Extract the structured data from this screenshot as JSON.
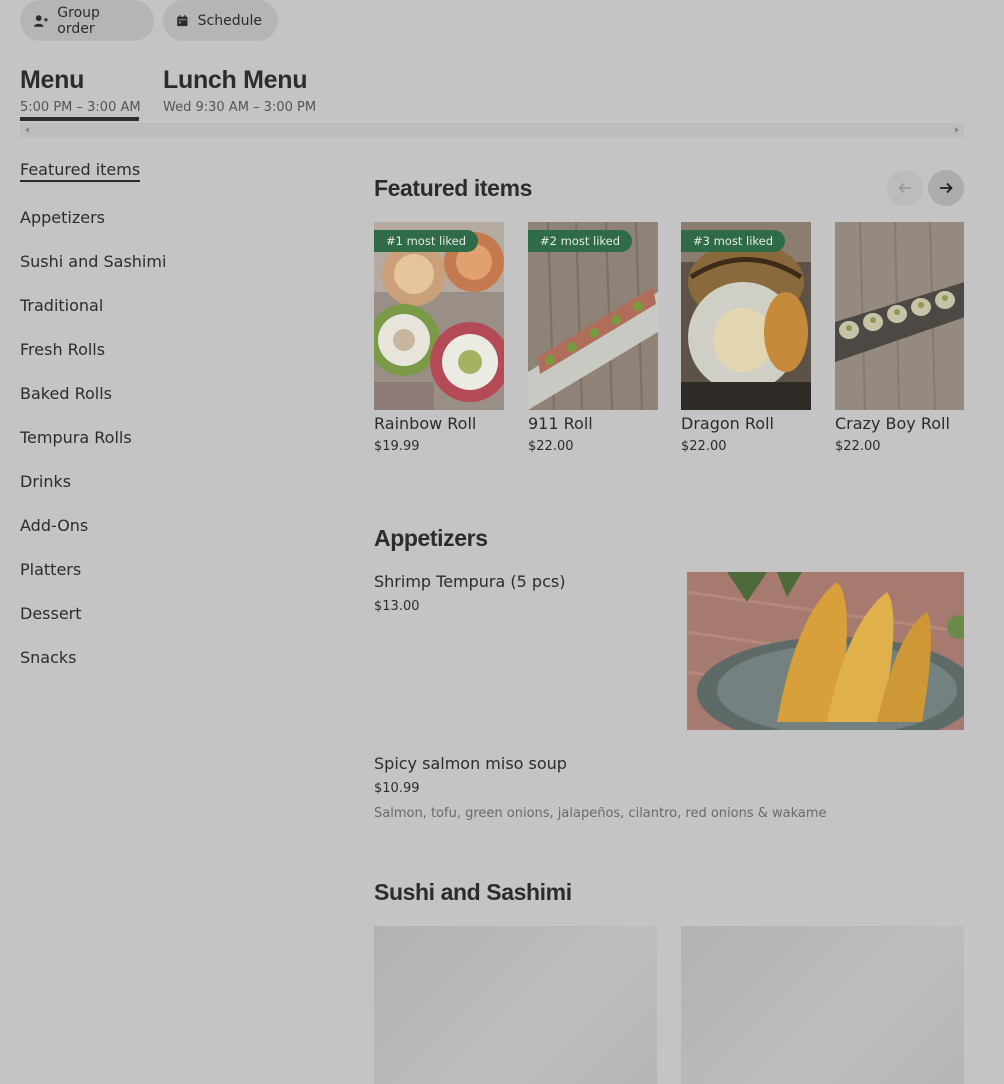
{
  "header": {
    "group_order_label": "Group order",
    "schedule_label": "Schedule"
  },
  "menus": [
    {
      "title": "Menu",
      "hours": "5:00 PM – 3:00 AM",
      "active": true
    },
    {
      "title": "Lunch Menu",
      "hours": "Wed 9:30 AM – 3:00 PM",
      "active": false
    }
  ],
  "sidenav": [
    "Featured items",
    "Appetizers",
    "Sushi and Sashimi",
    "Traditional",
    "Fresh Rolls",
    "Baked Rolls",
    "Tempura Rolls",
    "Drinks",
    "Add-Ons",
    "Platters",
    "Dessert",
    "Snacks"
  ],
  "featured": {
    "title": "Featured items",
    "items": [
      {
        "badge": "#1 most liked",
        "name": "Rainbow Roll",
        "price": "$19.99"
      },
      {
        "badge": "#2 most liked",
        "name": "911 Roll",
        "price": "$22.00"
      },
      {
        "badge": "#3 most liked",
        "name": "Dragon Roll",
        "price": "$22.00"
      },
      {
        "badge": "",
        "name": "Crazy Boy Roll",
        "price": "$22.00"
      }
    ]
  },
  "appetizers": {
    "title": "Appetizers",
    "items": [
      {
        "name": "Shrimp Tempura (5 pcs)",
        "price": "$13.00",
        "desc": ""
      },
      {
        "name": "Spicy salmon miso soup",
        "price": "$10.99",
        "desc": "Salmon, tofu, green onions, jalapeños, cilantro, red onions & wakame"
      }
    ]
  },
  "sushi_sashimi": {
    "title": "Sushi and Sashimi"
  },
  "icons": {
    "group_order": "person-add-icon",
    "schedule": "calendar-icon",
    "prev": "arrow-left-icon",
    "next": "arrow-right-icon"
  },
  "colors": {
    "badge": "#2f6b47",
    "overlay_bg": "#c4c4c4"
  }
}
